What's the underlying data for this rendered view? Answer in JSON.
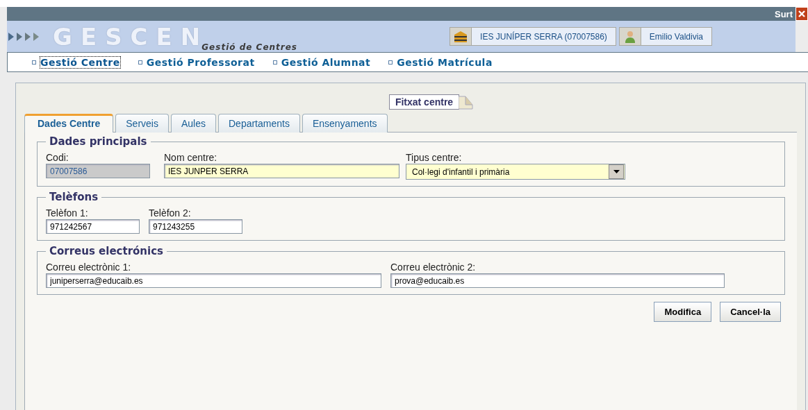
{
  "header": {
    "exit_label": "Surt",
    "logo": "GESCEN",
    "logo_subtitle": "Gestió de Centres",
    "centre": "IES JUNÍPER SERRA (07007586)",
    "user": "Emilio Valdivia"
  },
  "nav": [
    {
      "label": "Gestió Centre",
      "selected": true
    },
    {
      "label": "Gestió Professorat",
      "selected": false
    },
    {
      "label": "Gestió Alumnat",
      "selected": false
    },
    {
      "label": "Gestió Matrícula",
      "selected": false
    }
  ],
  "pinned_label": "Fitxat centre",
  "tabs": [
    {
      "label": "Dades Centre",
      "selected": true
    },
    {
      "label": "Serveis",
      "selected": false
    },
    {
      "label": "Aules",
      "selected": false
    },
    {
      "label": "Departaments",
      "selected": false
    },
    {
      "label": "Ensenyaments",
      "selected": false
    }
  ],
  "groups": [
    {
      "title": "Dades principals",
      "fields": [
        {
          "label": "Codi:",
          "value": "07007586",
          "kind": "text",
          "disabled": true,
          "required": false
        },
        {
          "label": "Nom centre:",
          "value": "IES JUNPER SERRA",
          "kind": "text",
          "disabled": false,
          "required": true
        },
        {
          "label": "Tipus centre:",
          "value": "Col·legi d'infantil i primària",
          "kind": "select",
          "disabled": false,
          "required": true
        }
      ]
    },
    {
      "title": "Telèfons",
      "fields": [
        {
          "label": "Telèfon 1:",
          "value": "971242567",
          "kind": "text",
          "disabled": false,
          "required": false
        },
        {
          "label": "Telèfon 2:",
          "value": "971243255",
          "kind": "text",
          "disabled": false,
          "required": false
        }
      ]
    },
    {
      "title": "Correus electrónics",
      "fields": [
        {
          "label": "Correu electrònic 1:",
          "value": "juniperserra@educaib.es",
          "kind": "text",
          "disabled": false,
          "required": false
        },
        {
          "label": "Correu electrònic 2:",
          "value": "prova@educaib.es",
          "kind": "text",
          "disabled": false,
          "required": false
        }
      ]
    }
  ],
  "buttons": [
    "Modifica",
    "Cancel·la"
  ]
}
